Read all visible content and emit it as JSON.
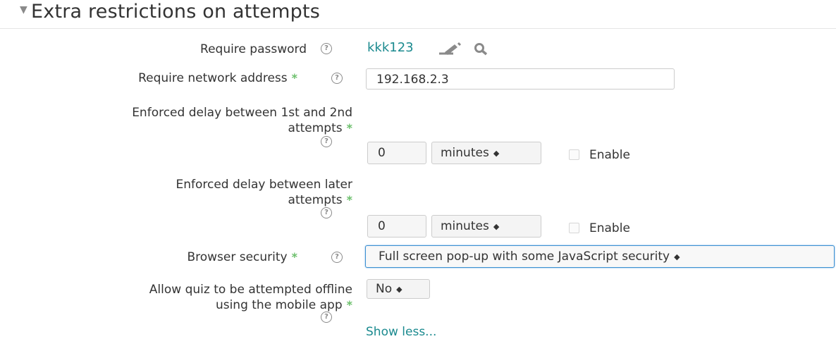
{
  "section": {
    "collapse_icon": "triangle-down-icon",
    "title": "Extra restrictions on attempts"
  },
  "fields": {
    "require_password": {
      "label": "Require password",
      "value": "kkk123",
      "edit_icon": "pencil-icon",
      "reveal_icon": "search-icon"
    },
    "require_network": {
      "label": "Require network address",
      "value": "192.168.2.3"
    },
    "delay_first": {
      "label_line1": "Enforced delay between 1st and 2nd",
      "label_line2": "attempts",
      "value": "0",
      "unit": "minutes",
      "enable_label": "Enable",
      "enabled": false
    },
    "delay_later": {
      "label_line1": "Enforced delay between later",
      "label_line2": "attempts",
      "value": "0",
      "unit": "minutes",
      "enable_label": "Enable",
      "enabled": false
    },
    "browser_security": {
      "label": "Browser security",
      "value": "Full screen pop-up with some JavaScript security"
    },
    "offline": {
      "label_line1": "Allow quiz to be attempted offline",
      "label_line2": "using the mobile app",
      "value": "No"
    }
  },
  "show_less": "Show less...",
  "colors": {
    "link": "#1b8a8f",
    "required": "#6bbf6b",
    "focus_border": "#3b8fd1"
  }
}
